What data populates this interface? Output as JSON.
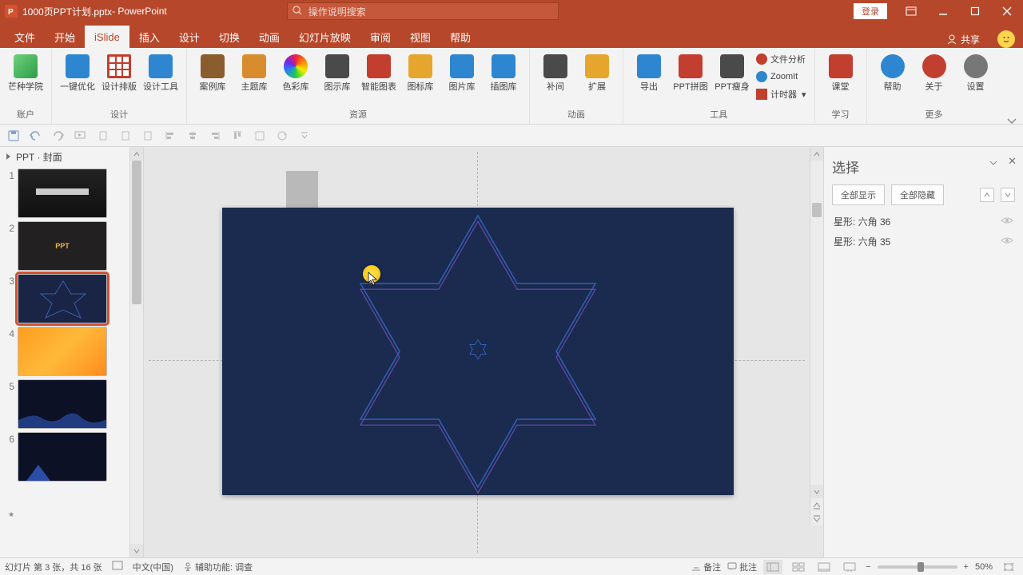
{
  "titlebar": {
    "filename": "1000页PPT计划.pptx",
    "app_suffix": "  -  PowerPoint",
    "search_placeholder": "操作说明搜索",
    "login": "登录"
  },
  "tabs": {
    "file": "文件",
    "home": "开始",
    "islide": "iSlide",
    "insert": "插入",
    "design": "设计",
    "transitions": "切换",
    "animations": "动画",
    "slideshow": "幻灯片放映",
    "review": "审阅",
    "view": "视图",
    "help": "帮助",
    "share": "共享"
  },
  "ribbon": {
    "group_account": "账户",
    "group_design": "设计",
    "group_resource": "资源",
    "group_animation": "动画",
    "group_tool": "工具",
    "group_learn": "学习",
    "group_more": "更多",
    "btn_institute": "芒种学院",
    "btn_onekey": "一键优化",
    "btn_layout": "设计排版",
    "btn_designtool": "设计工具",
    "btn_caselib": "案例库",
    "btn_themelib": "主题库",
    "btn_colorlib": "色彩库",
    "btn_diagram": "图示库",
    "btn_smartdiag": "智能图表",
    "btn_iconlib": "图标库",
    "btn_piclib": "图片库",
    "btn_illust": "插图库",
    "btn_buma": "补间",
    "btn_extend": "扩展",
    "btn_export": "导出",
    "btn_pptstitch": "PPT拼图",
    "btn_pptslim": "PPT瘦身",
    "btn_fileanalyze": "文件分析",
    "btn_zoomit": "ZoomIt",
    "btn_timer": "计时器",
    "btn_lesson": "课堂",
    "btn_helpbtn": "帮助",
    "btn_about": "关于",
    "btn_settings": "设置"
  },
  "thumbnails": {
    "header": "PPT · 封面",
    "items": [
      "1",
      "2",
      "3",
      "4",
      "5",
      "6"
    ],
    "slide2_text": "PPT"
  },
  "selection_pane": {
    "title": "选择",
    "show_all": "全部显示",
    "hide_all": "全部隐藏",
    "item1": "星形: 六角 36",
    "item2": "星形: 六角 35"
  },
  "statusbar": {
    "slide_info": "幻灯片 第 3 张，共 16 张",
    "language": "中文(中国)",
    "accessibility": "辅助功能: 调查",
    "notes": "备注",
    "comments": "批注",
    "zoom": "50%"
  }
}
